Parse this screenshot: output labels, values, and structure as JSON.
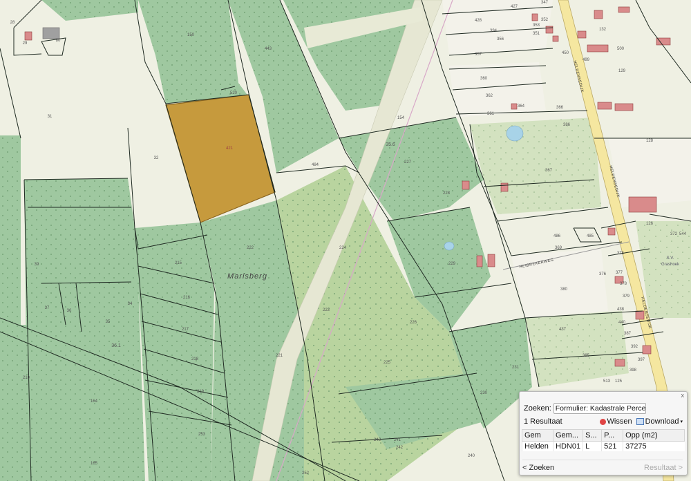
{
  "map": {
    "parcel_numbers": [
      "29",
      "80",
      "150",
      "443",
      "31",
      "520",
      "421",
      "32",
      "484",
      "154",
      "35.6",
      "227",
      "228",
      "222",
      "215",
      "224",
      "216",
      "217",
      "218",
      "219",
      "221",
      "223",
      "225",
      "226",
      "229",
      "230",
      "231",
      "164",
      "165",
      "253",
      "36.1",
      "35",
      "36",
      "37",
      "34",
      "39",
      "210",
      "240",
      "241",
      "242",
      "243",
      "252",
      "28",
      "428",
      "394",
      "356",
      "357",
      "360",
      "362",
      "361",
      "364",
      "366",
      "367",
      "386",
      "380",
      "437",
      "385",
      "427",
      "347",
      "352",
      "353",
      "351",
      "450",
      "499",
      "500",
      "132",
      "129",
      "128",
      "126",
      "372",
      "544",
      "486",
      "485",
      "369",
      "376",
      "375",
      "377",
      "378",
      "379",
      "438",
      "387",
      "392",
      "397",
      "398",
      "513",
      "125",
      "440"
    ],
    "place_names": [
      "Marisberg"
    ],
    "street_names": [
      "HELDENSEDIJK",
      "HELDENSEDIJK",
      "HEIBREKERWEG",
      "HELDENSEDIJK"
    ],
    "poi_labels": [
      "S.V.",
      "Grashoek"
    ],
    "selected_parcel": "421",
    "colors": {
      "selected_fill": "#c69a3d",
      "forest": "#9dc79a",
      "meadow": "#cde0bf",
      "plain": "#f1f0e4",
      "building": "#d47a7a",
      "road": "#f7e9a6",
      "water": "#a9d2e6"
    }
  },
  "panel": {
    "zoeken_label": "Zoeken:",
    "form_value": "Formulier: Kadastrale Perce",
    "close_label": "x",
    "result_count": "1 Resultaat",
    "wissen_label": "Wissen",
    "download_label": "Download",
    "columns": [
      "Gem",
      "Gem...",
      "S...",
      "P...",
      "Opp (m2)"
    ],
    "rows": [
      [
        "Helden",
        "HDN01",
        "L",
        "521",
        "37275"
      ]
    ],
    "back_label": "< Zoeken",
    "next_label": "Resultaat >"
  }
}
